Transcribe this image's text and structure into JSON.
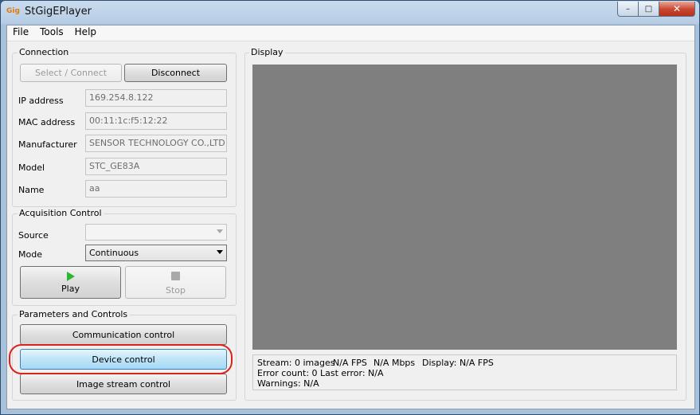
{
  "window": {
    "title": "StGigEPlayer",
    "icon_text": "Gig"
  },
  "menu": {
    "file": "File",
    "tools": "Tools",
    "help": "Help"
  },
  "connection": {
    "title": "Connection",
    "select_connect": "Select / Connect",
    "disconnect": "Disconnect",
    "ip_label": "IP address",
    "ip_value": "169.254.8.122",
    "mac_label": "MAC address",
    "mac_value": "00:11:1c:f5:12:22",
    "manufacturer_label": "Manufacturer",
    "manufacturer_value": "SENSOR TECHNOLOGY CO.,LTD",
    "model_label": "Model",
    "model_value": "STC_GE83A",
    "name_label": "Name",
    "name_value": "aa"
  },
  "acquisition": {
    "title": "Acquisition Control",
    "source_label": "Source",
    "source_value": "",
    "mode_label": "Mode",
    "mode_value": "Continuous",
    "play": "Play",
    "stop": "Stop"
  },
  "parameters": {
    "title": "Parameters and Controls",
    "communication": "Communication control",
    "device": "Device control",
    "image_stream": "Image stream control"
  },
  "display": {
    "title": "Display",
    "stream": "Stream: 0 images",
    "fps": "N/A FPS",
    "mbps": "N/A Mbps",
    "display_fps": "Display: N/A FPS",
    "error_count": "Error count: 0",
    "last_error": "Last error: N/A",
    "warnings": "Warnings: N/A"
  },
  "colors": {
    "highlight": "#d9231d",
    "display_bg": "#7f7f7f",
    "play_icon": "#2fb52f"
  }
}
